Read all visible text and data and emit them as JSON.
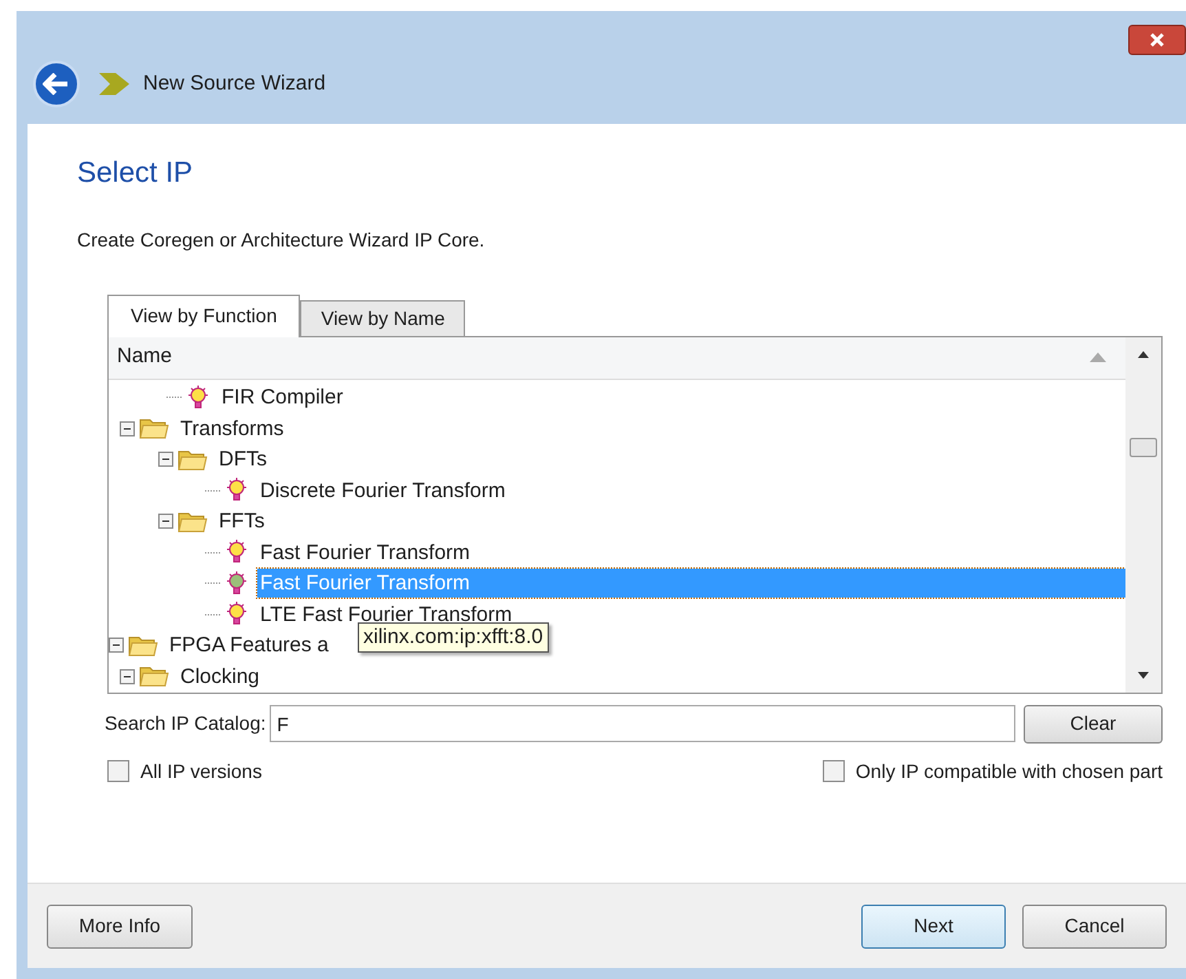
{
  "window": {
    "title": "New Source Wizard"
  },
  "page": {
    "heading": "Select IP",
    "description": "Create Coregen or Architecture Wizard IP Core."
  },
  "tabs": [
    {
      "label": "View by Function",
      "selected": true
    },
    {
      "label": "View by Name",
      "selected": false
    }
  ],
  "tree": {
    "column": "Name",
    "items": [
      {
        "children": [
          {
            "children": [
              {
                "label": "FIR Compiler",
                "kind": "core",
                "selected": false
              }
            ]
          },
          {
            "label": "Transforms",
            "kind": "folder",
            "expanded": true,
            "selected": false,
            "children": [
              {
                "label": "DFTs",
                "kind": "folder",
                "expanded": true,
                "selected": false,
                "children": [
                  {
                    "label": "Discrete Fourier Transform",
                    "kind": "core",
                    "selected": false
                  }
                ]
              },
              {
                "label": "FFTs",
                "kind": "folder",
                "expanded": true,
                "selected": false,
                "children": [
                  {
                    "label": "Fast Fourier Transform",
                    "kind": "core",
                    "selected": false
                  },
                  {
                    "label": "Fast Fourier Transform",
                    "kind": "core",
                    "selected": true
                  },
                  {
                    "label": "LTE Fast Fourier Transform",
                    "kind": "core",
                    "selected": false
                  }
                ]
              }
            ]
          }
        ]
      },
      {
        "label": "FPGA Features a",
        "kind": "folder",
        "expanded": true,
        "selected": false,
        "children": [
          {
            "label": "Clocking",
            "kind": "folder",
            "expanded": true,
            "selected": false
          }
        ]
      }
    ]
  },
  "tooltip": "xilinx.com:ip:xfft:8.0",
  "search": {
    "label": "Search IP Catalog:",
    "value": "F",
    "button": "Clear"
  },
  "options": [
    {
      "label": "All IP versions",
      "checked": false
    },
    {
      "label": "Only IP compatible with chosen part",
      "checked": false
    }
  ],
  "buttons": {
    "left": "More Info",
    "primary": "Next",
    "cancel": "Cancel"
  }
}
